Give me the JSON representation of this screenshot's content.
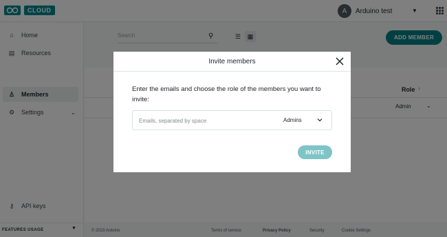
{
  "app": {
    "brand": "CLOUD"
  },
  "user": {
    "avatar_initial": "A",
    "name": "Arduino test"
  },
  "sidebar": {
    "items": [
      {
        "label": "Home",
        "icon": "home-icon"
      },
      {
        "label": "Resources",
        "icon": "resources-icon"
      },
      {
        "label": "Members",
        "icon": "members-icon",
        "active": true
      },
      {
        "label": "Settings",
        "icon": "gear-icon"
      },
      {
        "label": "API keys",
        "icon": "key-icon"
      }
    ],
    "features_usage": "FEATURES USAGE"
  },
  "main": {
    "search_placeholder": "Search",
    "add_member": "ADD MEMBER",
    "table": {
      "role_header": "Role",
      "row_role": "Admin"
    }
  },
  "footer": {
    "copyright": "© 2023 Arduino",
    "links": [
      "Terms of service",
      "Privacy Policy",
      "Security",
      "Cookie Settings"
    ]
  },
  "modal": {
    "title": "Invite members",
    "description": "Enter the emails and choose the role of the members you want to invite:",
    "email_placeholder": "Emails, separated by space",
    "role_value": "Admins",
    "invite_label": "INVITE"
  },
  "colors": {
    "accent": "#008184",
    "invite_disabled": "#7fc4c7",
    "overlay": "rgba(0,0,0,0.5)"
  }
}
